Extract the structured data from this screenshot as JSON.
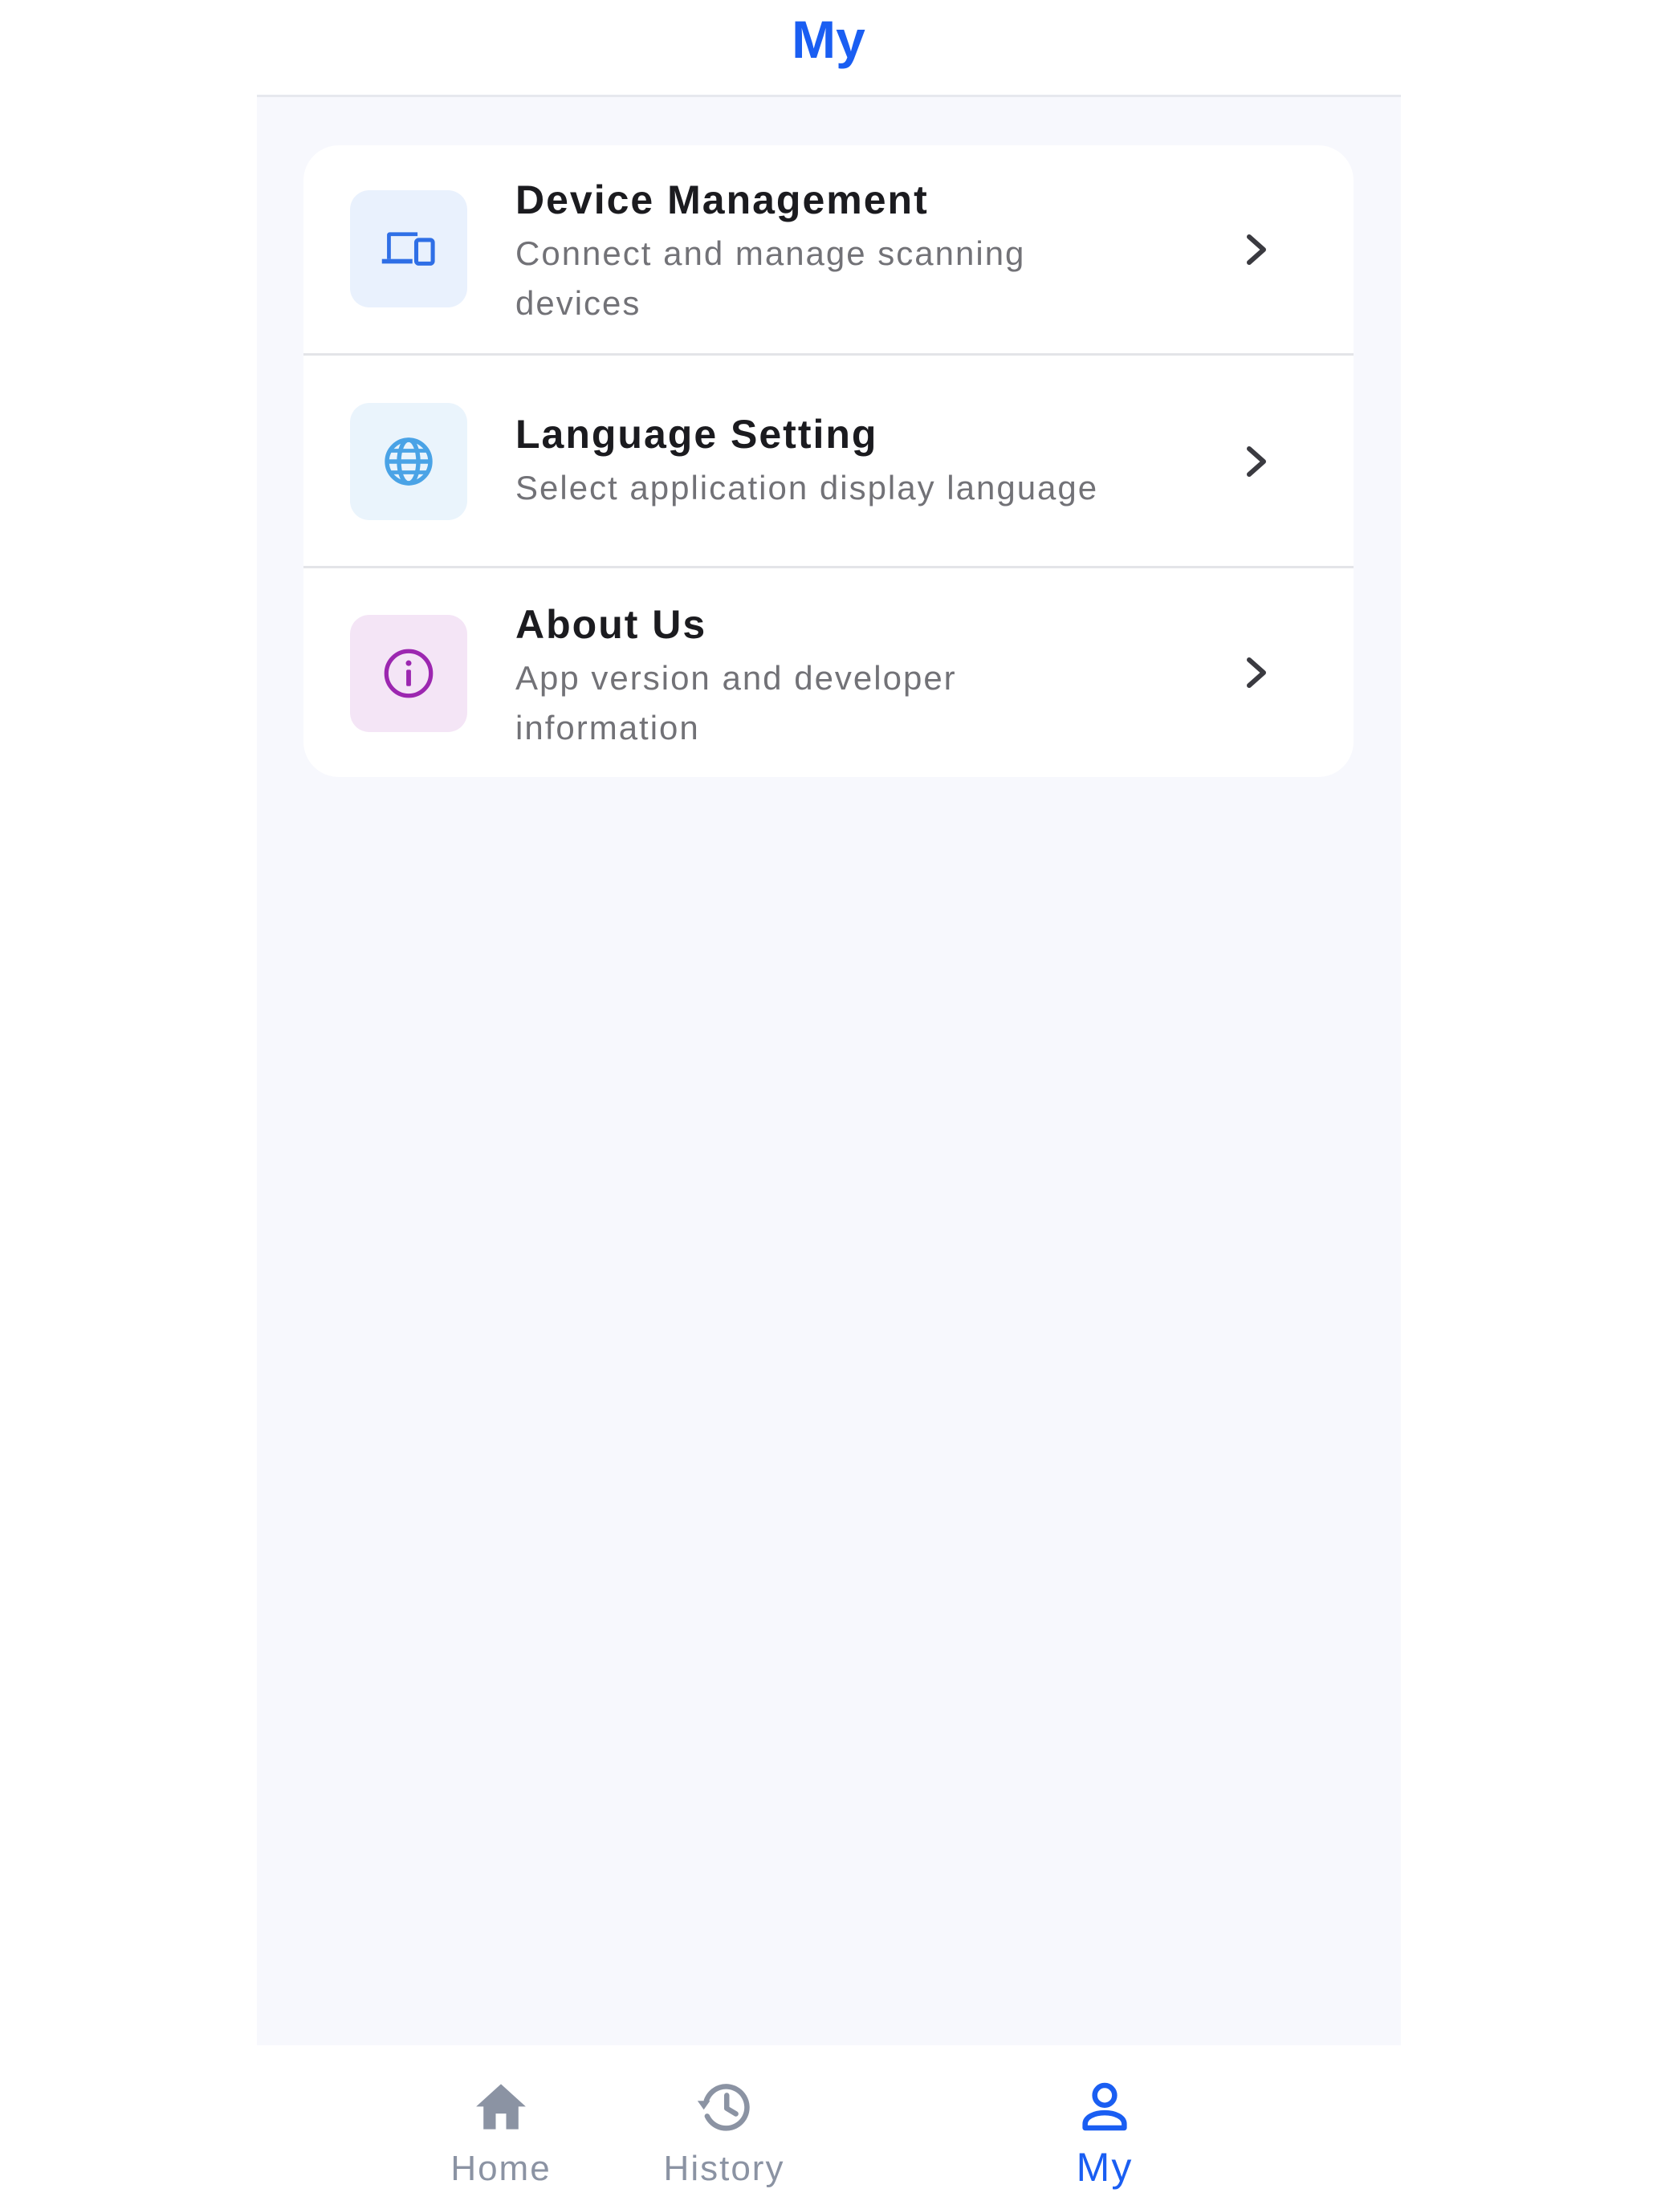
{
  "header": {
    "title": "My"
  },
  "menu": {
    "items": [
      {
        "title": "Device Management",
        "subtitle": "Connect and manage scanning devices",
        "icon": "devices-icon",
        "icon_color": "#2f6fe6",
        "icon_bg": "#e9f1fd"
      },
      {
        "title": "Language Setting",
        "subtitle": "Select application display language",
        "icon": "globe-icon",
        "icon_color": "#4aa3e6",
        "icon_bg": "#eaf4fc"
      },
      {
        "title": "About Us",
        "subtitle": "App version and developer information",
        "icon": "info-icon",
        "icon_color": "#9c27b0",
        "icon_bg": "#f4e5f6"
      }
    ]
  },
  "bottom_nav": {
    "tabs": [
      {
        "label": "Home",
        "icon": "home-icon",
        "active": false
      },
      {
        "label": "History",
        "icon": "history-icon",
        "active": false
      },
      {
        "label": "My",
        "icon": "person-icon",
        "active": true
      }
    ]
  },
  "colors": {
    "accent": "#1a5ef2",
    "inactive": "#8b93a3",
    "background": "#f7f8fd"
  }
}
